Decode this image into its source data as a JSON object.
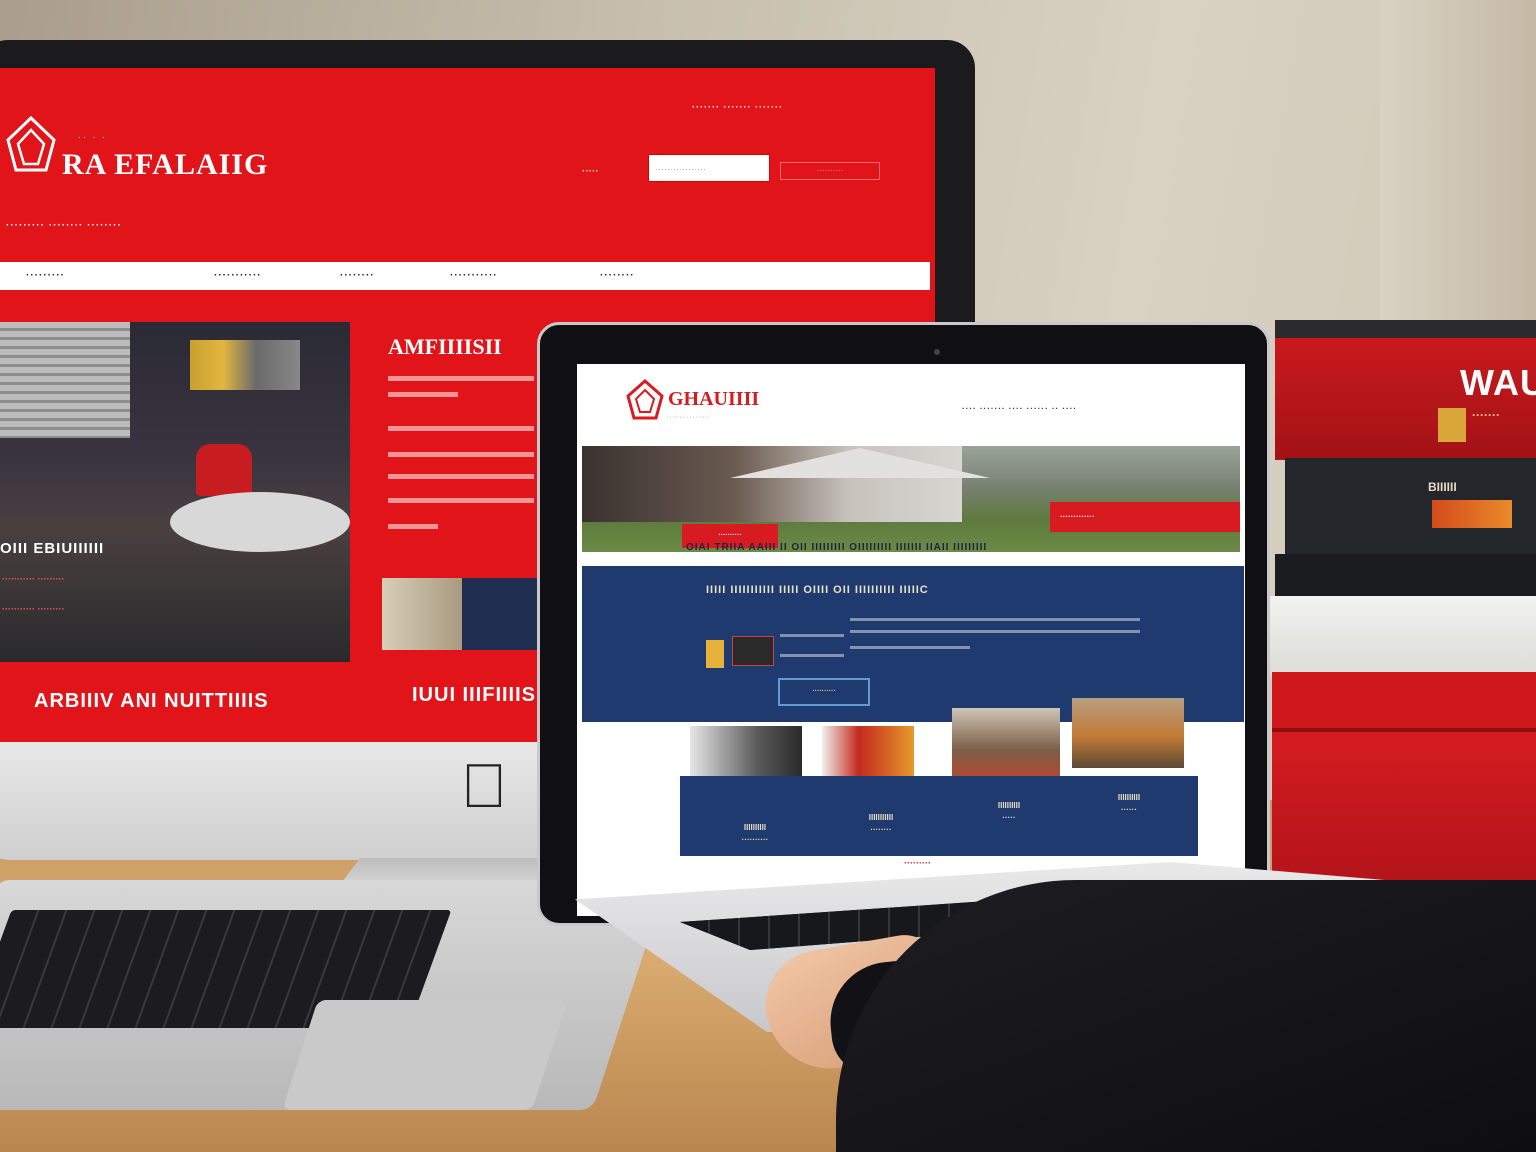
{
  "monitor_site": {
    "logo_text": "RA EFALAIIG",
    "logo_sub": "·· · ·",
    "top_links": "·······  ·······  ·······",
    "search_label": "·····",
    "search_placeholder": "·················",
    "search_button": "··········",
    "tagline": "·········  ········  ········",
    "nav": [
      "·········",
      "···········",
      "········",
      "···········",
      "········"
    ],
    "hero_caption": "OIII EBIUIIIIII",
    "hero_caption2": "···········  ·········",
    "hero_caption3": "···········  ·········",
    "about_title": "AMFIIIISII",
    "footer_left": "ARBIIIV ANI NUITTIIIIS",
    "footer_right": "IUUI IIIFIIIIS"
  },
  "laptop_site": {
    "logo_text": "GHAUIIII",
    "logo_sub": "·············",
    "nav": "····  ·······  ····  ······  ··  ····",
    "hero_red_text": "·············",
    "hero_button": "··········",
    "strapline": "OIAI TRIIA AAIII II OII IIIIIIIII OIIIIIIIII IIIIIII IIAII IIIIIIIII",
    "band_title": "IIIII IIIIIIIIIII IIIII OIIII OII IIIIIIIIII IIIIIC",
    "band_button": "··········",
    "gallery_label": "·······",
    "features": [
      "IIIIIIIIII\n··········",
      "IIIIIIIIIII\n········",
      "IIIIIIIIII\n·····",
      "IIIIIIIIII\n······"
    ],
    "footer": "·········"
  },
  "books": {
    "top_title": "WAU",
    "top_label": "·······",
    "dark_label": "BIIIIII"
  },
  "icons": {
    "monitor_logo": "house-shield-logo-icon",
    "laptop_logo": "house-shield-logo-icon",
    "apple": "apple-logo-icon"
  },
  "colors": {
    "brand_red": "#e11419",
    "navy": "#1e3a6e",
    "white": "#ffffff"
  }
}
